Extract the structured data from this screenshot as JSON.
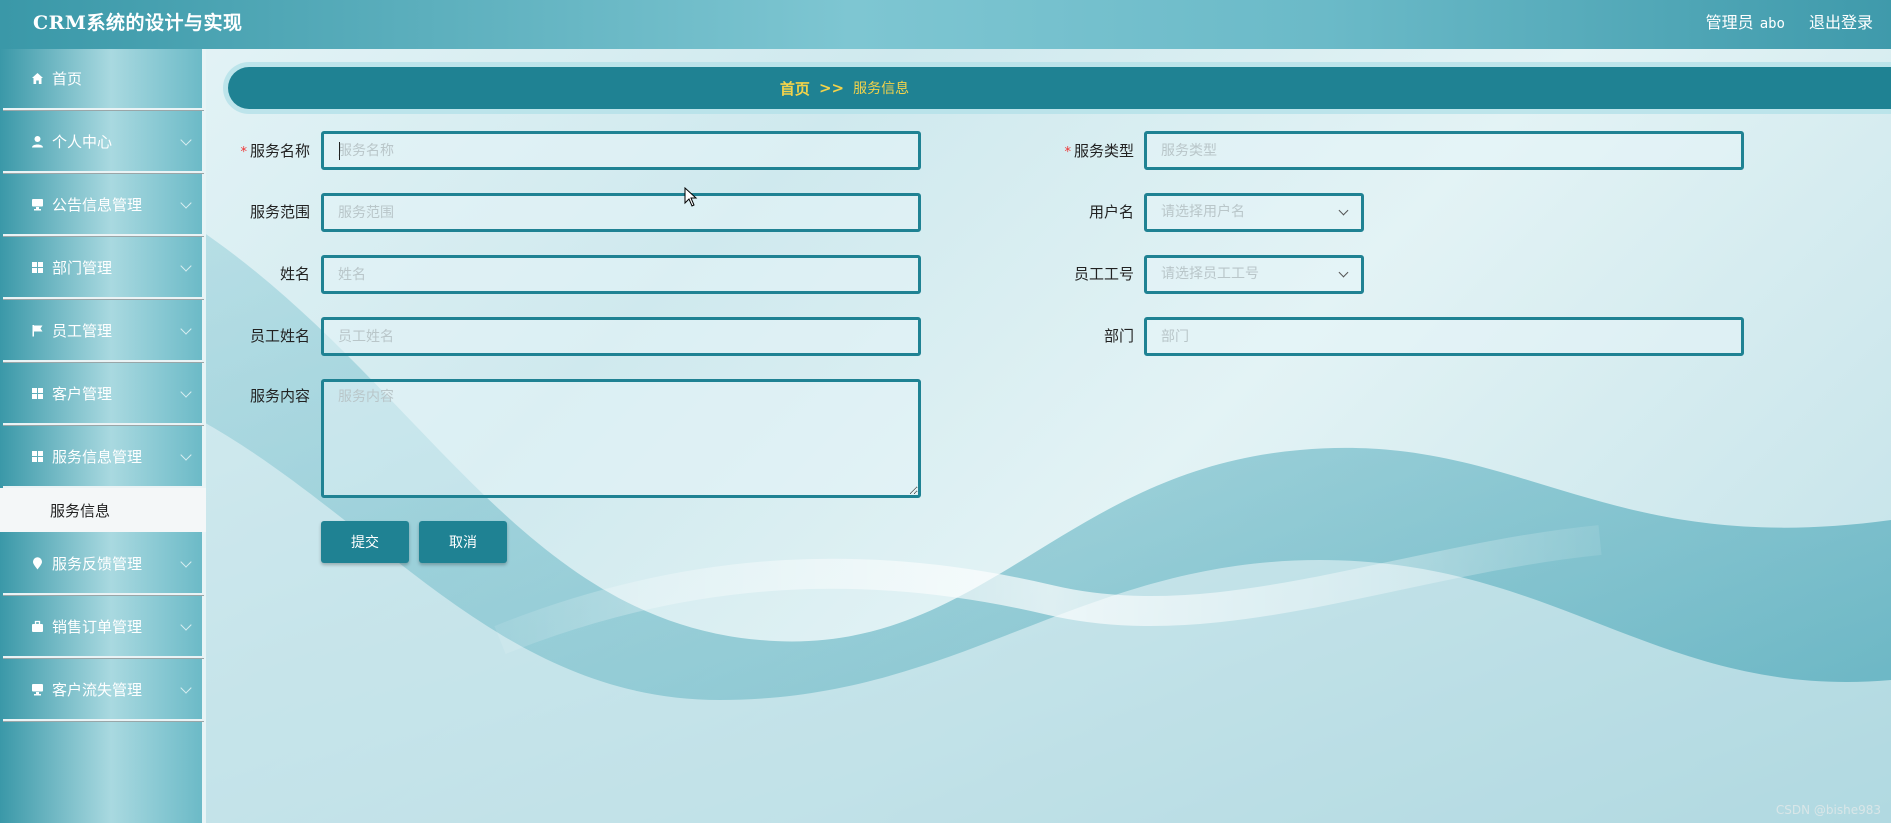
{
  "header": {
    "title": "CRM系统的设计与实现",
    "role": "管理员",
    "username": "abo",
    "logout": "退出登录"
  },
  "sidebar": {
    "items": [
      {
        "label": "首页",
        "icon": "home-icon"
      },
      {
        "label": "个人中心",
        "icon": "user-icon"
      },
      {
        "label": "公告信息管理",
        "icon": "desktop-icon"
      },
      {
        "label": "部门管理",
        "icon": "grid-icon"
      },
      {
        "label": "员工管理",
        "icon": "flag-icon"
      },
      {
        "label": "客户管理",
        "icon": "grid-icon"
      },
      {
        "label": "服务信息管理",
        "icon": "grid-icon"
      },
      {
        "label": "服务反馈管理",
        "icon": "map-pin-icon"
      },
      {
        "label": "销售订单管理",
        "icon": "briefcase-icon"
      },
      {
        "label": "客户流失管理",
        "icon": "desktop-icon"
      }
    ],
    "subitem": "服务信息"
  },
  "breadcrumb": {
    "home": "首页",
    "separator": ">>",
    "current": "服务信息"
  },
  "form": {
    "service_name": {
      "label": "服务名称",
      "placeholder": "服务名称",
      "required": true
    },
    "service_type": {
      "label": "服务类型",
      "placeholder": "服务类型",
      "required": true
    },
    "service_scope": {
      "label": "服务范围",
      "placeholder": "服务范围"
    },
    "username": {
      "label": "用户名",
      "placeholder": "请选择用户名"
    },
    "name": {
      "label": "姓名",
      "placeholder": "姓名"
    },
    "employee_id": {
      "label": "员工工号",
      "placeholder": "请选择员工工号"
    },
    "employee_name": {
      "label": "员工姓名",
      "placeholder": "员工姓名"
    },
    "department": {
      "label": "部门",
      "placeholder": "部门"
    },
    "service_content": {
      "label": "服务内容",
      "placeholder": "服务内容"
    },
    "submit": "提交",
    "cancel": "取消",
    "required_mark": "*"
  },
  "watermark": "CSDN @bishe983",
  "colors": {
    "accent": "#1f8293",
    "breadcrumb_text": "#f3d34a",
    "required": "#e33333"
  }
}
